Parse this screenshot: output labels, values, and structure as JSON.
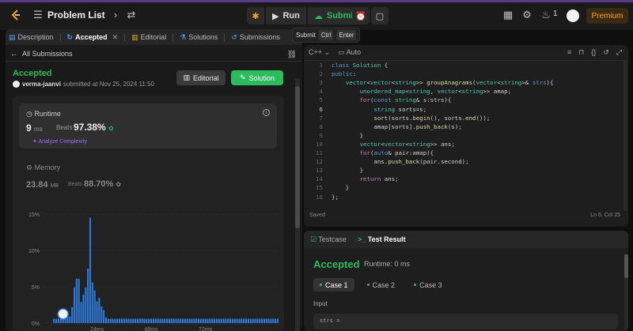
{
  "topbar": {
    "problem_list": "Problem List",
    "run": "Run",
    "submit": "Submit",
    "streak": "1",
    "premium": "Premium",
    "tooltip": {
      "label": "Submit",
      "key1": "Ctrl",
      "key2": "Enter"
    }
  },
  "left_tabs": [
    {
      "label": "Description"
    },
    {
      "label": "Accepted"
    },
    {
      "label": "Editorial"
    },
    {
      "label": "Solutions"
    },
    {
      "label": "Submissions"
    }
  ],
  "submission": {
    "back_label": "All Submissions",
    "status": "Accepted",
    "user": "verma-jaanvi",
    "submitted_text": "submitted at Nov 25, 2024 11:50",
    "editorial_btn": "Editorial",
    "solution_btn": "Solution",
    "runtime": {
      "label": "Runtime",
      "value": "9",
      "unit": "ms",
      "beats_label": "Beats",
      "beats": "97.38%",
      "analyze": "Analyze Complexity"
    },
    "memory": {
      "label": "Memory",
      "value": "23.84",
      "unit": "MB",
      "beats_label": "Beats",
      "beats": "88.70%"
    }
  },
  "chart_data": {
    "type": "bar",
    "title": "",
    "xlabel": "",
    "ylabel": "",
    "y_ticks": [
      "15%",
      "10%",
      "5%",
      "0%"
    ],
    "x_ticks": [
      "24ms",
      "48ms",
      "72ms"
    ],
    "ylim": [
      0,
      15
    ],
    "x_range_ms": [
      0,
      104
    ],
    "bar_width_ms": 1,
    "x": [
      5,
      6,
      7,
      8,
      9,
      10,
      11,
      12,
      13,
      14,
      15,
      16,
      17,
      18,
      19,
      20,
      21,
      22,
      23,
      24,
      25,
      26,
      27,
      28,
      29,
      30,
      31,
      32,
      33,
      34,
      35,
      36,
      37,
      38,
      39,
      40,
      41,
      42,
      43,
      44,
      45,
      46,
      47,
      48,
      49,
      50,
      51,
      52,
      53,
      54,
      55,
      56,
      57,
      58,
      59,
      60,
      61,
      62,
      63,
      64,
      65,
      66,
      67,
      68,
      69,
      70,
      71,
      72,
      73,
      74,
      75,
      76,
      77,
      78,
      79,
      80,
      81,
      82,
      83,
      84,
      85,
      86,
      87,
      88,
      89,
      90,
      91,
      92,
      93,
      94,
      95,
      96,
      97,
      98,
      99,
      100,
      101,
      102,
      103,
      104
    ],
    "values": [
      0.6,
      0.6,
      0.6,
      0.6,
      0.6,
      0.6,
      1.4,
      0.9,
      2.2,
      4.9,
      6.1,
      6.1,
      2.9,
      3.9,
      4.9,
      7.5,
      14.5,
      5.6,
      4.5,
      3.0,
      3.5,
      2.3,
      1.8,
      0.8,
      0.6,
      0.6,
      0.6,
      0.6,
      0.6,
      0.6,
      0.6,
      0.6,
      0.6,
      0.6,
      0.6,
      0.6,
      0.6,
      0.6,
      0.6,
      0.6,
      0.6,
      0.6,
      0.6,
      0.6,
      0.6,
      0.6,
      0.6,
      0.6,
      0.6,
      0.6,
      0.6,
      0.6,
      0.6,
      0.6,
      0.6,
      0.6,
      0.6,
      0.6,
      0.6,
      0.6,
      0.6,
      0.6,
      0.6,
      0.6,
      0.6,
      0.6,
      0.6,
      0.6,
      0.6,
      0.6,
      0.6,
      0.6,
      0.6,
      0.6,
      0.6,
      0.6,
      0.6,
      0.6,
      0.6,
      0.6,
      0.6,
      0.6,
      0.6,
      0.6,
      0.6,
      0.6,
      0.6,
      0.6,
      0.6,
      0.6,
      0.6,
      0.6,
      0.6,
      0.6,
      0.6,
      0.6,
      0.6,
      0.6,
      0.6,
      0.6
    ],
    "marker_x": 9,
    "colors": {
      "bar": "#2f7bdc",
      "grid": "#333333",
      "tick": "#888888"
    }
  },
  "editor": {
    "language": "C++",
    "mode": "Auto",
    "status": "Saved",
    "cursor": "Ln 6, Col 25",
    "line_numbers": [
      "1",
      "2",
      "3",
      "4",
      "5",
      "6",
      "7",
      "8",
      "9",
      "10",
      "11",
      "12",
      "13",
      "14",
      "15",
      "16"
    ]
  },
  "result": {
    "tabs": [
      {
        "label": "Testcase"
      },
      {
        "label": "Test Result"
      }
    ],
    "status": "Accepted",
    "runtime": "Runtime: 0 ms",
    "cases": [
      {
        "label": "Case 1"
      },
      {
        "label": "Case 2"
      },
      {
        "label": "Case 3"
      }
    ],
    "input_label": "Input",
    "input_value": "strs ="
  },
  "colors": {
    "accent_green": "#2cbb5d",
    "premium": "#ffa116",
    "purple": "#a36bff"
  }
}
